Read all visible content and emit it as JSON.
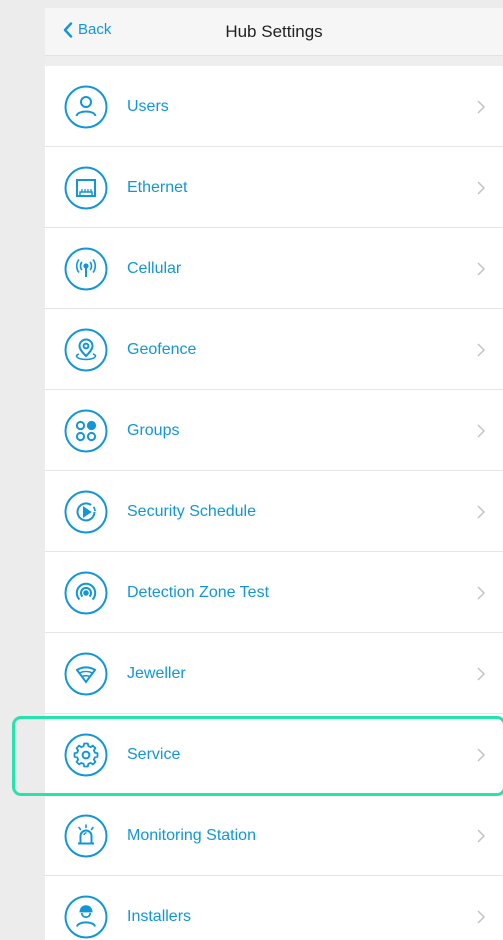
{
  "header": {
    "back_label": "Back",
    "title": "Hub Settings"
  },
  "colors": {
    "accent": "#1296d8",
    "highlight": "#25e3ab",
    "chevron": "#c4c4c4"
  },
  "items": [
    {
      "label": "Users",
      "icon": "user-icon"
    },
    {
      "label": "Ethernet",
      "icon": "ethernet-icon"
    },
    {
      "label": "Cellular",
      "icon": "cellular-icon"
    },
    {
      "label": "Geofence",
      "icon": "geofence-icon"
    },
    {
      "label": "Groups",
      "icon": "groups-icon"
    },
    {
      "label": "Security Schedule",
      "icon": "schedule-icon"
    },
    {
      "label": "Detection Zone Test",
      "icon": "detection-zone-icon"
    },
    {
      "label": "Jeweller",
      "icon": "jeweller-icon"
    },
    {
      "label": "Service",
      "icon": "gear-icon",
      "highlighted": true
    },
    {
      "label": "Monitoring Station",
      "icon": "siren-icon"
    },
    {
      "label": "Installers",
      "icon": "installer-icon"
    }
  ]
}
